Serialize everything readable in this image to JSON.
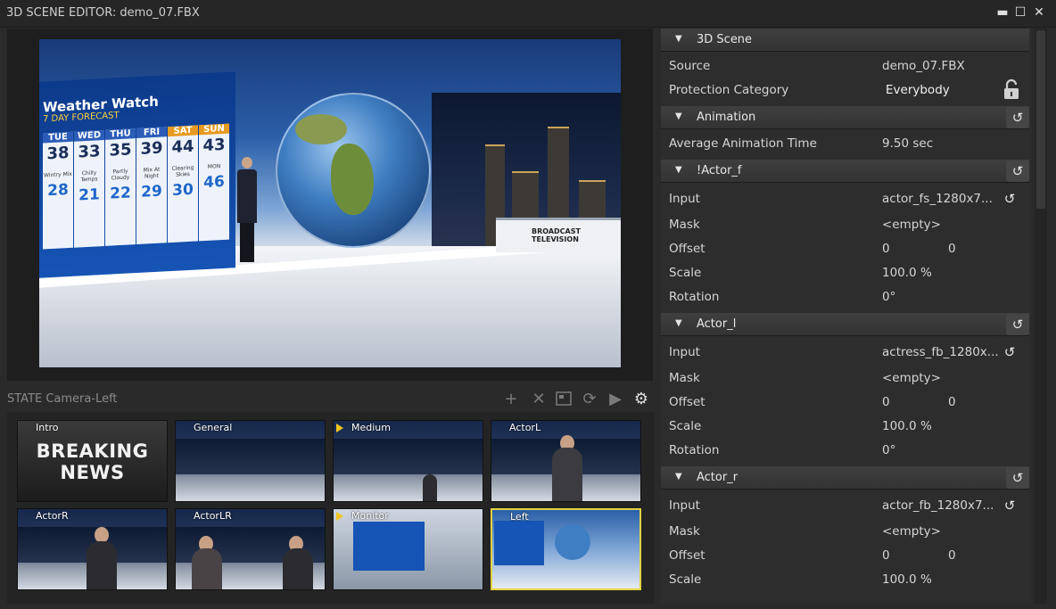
{
  "window": {
    "title": "3D SCENE EDITOR: demo_07.FBX",
    "minimize_glyph": "▬",
    "maximize_glyph": "☐",
    "close_glyph": "✕"
  },
  "viewport": {
    "weather_title": "Weather Watch",
    "weather_subtitle": "7 DAY FORECAST",
    "days": [
      {
        "day": "TUE",
        "hi": "38",
        "lo": "28",
        "cond": "Wintry Mix"
      },
      {
        "day": "WED",
        "hi": "33",
        "lo": "21",
        "cond": "Chilly Temps"
      },
      {
        "day": "THU",
        "hi": "35",
        "lo": "22",
        "cond": "Partly Cloudy"
      },
      {
        "day": "FRI",
        "hi": "39",
        "lo": "29",
        "cond": "Mix At Night"
      },
      {
        "day": "SAT",
        "hi": "44",
        "lo": "30",
        "cond": "Clearing Skies"
      },
      {
        "day": "SUN",
        "hi": "43",
        "lo": "46",
        "cond": "MON"
      }
    ],
    "desk_logo": "BROADCAST TELEVISION"
  },
  "state": {
    "label": "STATE Camera-Left",
    "tools": [
      "add-icon",
      "delete-icon",
      "image-icon",
      "refresh-icon",
      "play-icon",
      "gear-icon"
    ]
  },
  "thumbnails": [
    {
      "label": "Intro",
      "text": "BREAKING NEWS",
      "selected": false,
      "arrow": false
    },
    {
      "label": "General",
      "selected": false,
      "arrow": false
    },
    {
      "label": "Medium",
      "selected": false,
      "arrow": true
    },
    {
      "label": "ActorL",
      "selected": false,
      "arrow": false
    },
    {
      "label": "ActorR",
      "selected": false,
      "arrow": false
    },
    {
      "label": "ActorLR",
      "selected": false,
      "arrow": false
    },
    {
      "label": "Monitor",
      "selected": false,
      "arrow": true
    },
    {
      "label": "Left",
      "selected": true,
      "arrow": false
    }
  ],
  "props": {
    "scene_header": "3D Scene",
    "source_label": "Source",
    "source_value": "demo_07.FBX",
    "protection_label": "Protection Category",
    "protection_value": "Everybody",
    "animation_header": "Animation",
    "avg_anim_label": "Average Animation Time",
    "avg_anim_value": "9.50 sec",
    "actors": [
      {
        "header": "!Actor_f",
        "input_label": "Input",
        "input_value": "actor_fs_1280x7...",
        "mask_label": "Mask",
        "mask_value": "<empty>",
        "offset_label": "Offset",
        "offset_x": "0",
        "offset_y": "0",
        "scale_label": "Scale",
        "scale_value": "100.0 %",
        "rotation_label": "Rotation",
        "rotation_value": "0°"
      },
      {
        "header": "Actor_l",
        "input_label": "Input",
        "input_value": "actress_fb_1280x...",
        "mask_label": "Mask",
        "mask_value": "<empty>",
        "offset_label": "Offset",
        "offset_x": "0",
        "offset_y": "0",
        "scale_label": "Scale",
        "scale_value": "100.0 %",
        "rotation_label": "Rotation",
        "rotation_value": "0°"
      },
      {
        "header": "Actor_r",
        "input_label": "Input",
        "input_value": "actor_fb_1280x7...",
        "mask_label": "Mask",
        "mask_value": "<empty>",
        "offset_label": "Offset",
        "offset_x": "0",
        "offset_y": "0",
        "scale_label": "Scale",
        "scale_value": "100.0 %"
      }
    ],
    "reset_glyph": "↺",
    "collapse_glyph": "▼"
  }
}
